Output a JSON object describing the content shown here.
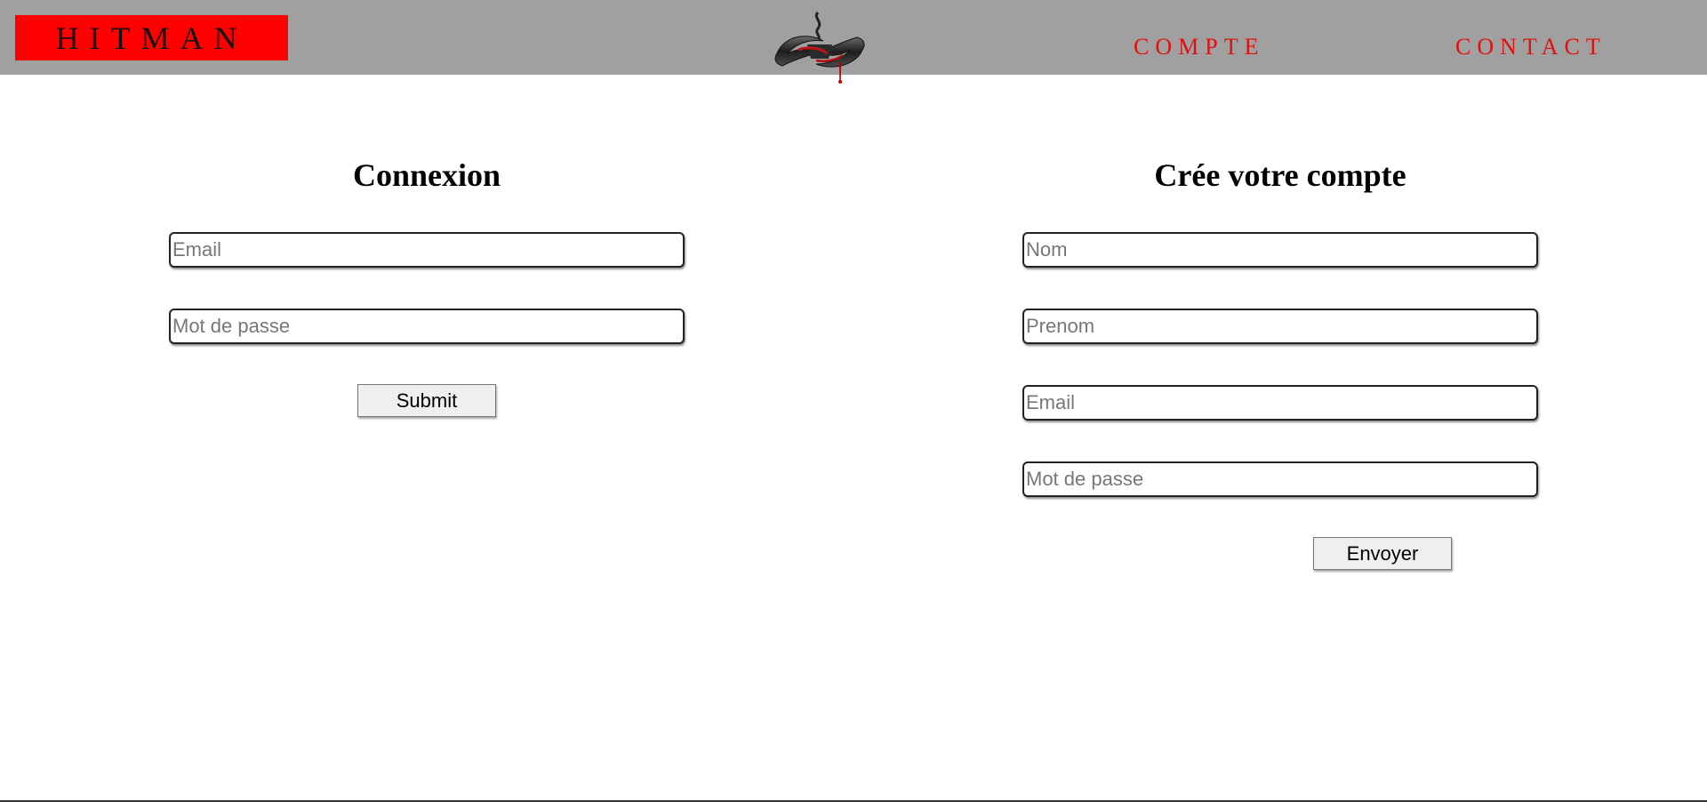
{
  "header": {
    "brand": "HITMAN",
    "logo_icon": "hitman-logo-icon",
    "nav": [
      {
        "label": "COMPTE"
      },
      {
        "label": "CONTACT"
      }
    ],
    "colors": {
      "header_bg": "#a0a0a0",
      "brand_bg": "#ff0000",
      "nav_text": "#e01010"
    }
  },
  "login": {
    "title": "Connexion",
    "email_placeholder": "Email",
    "password_placeholder": "Mot de passe",
    "submit_label": "Submit"
  },
  "register": {
    "title": "Crée votre compte",
    "nom_placeholder": "Nom",
    "prenom_placeholder": "Prenom",
    "email_placeholder": "Email",
    "password_placeholder": "Mot de passe",
    "submit_label": "Envoyer"
  }
}
